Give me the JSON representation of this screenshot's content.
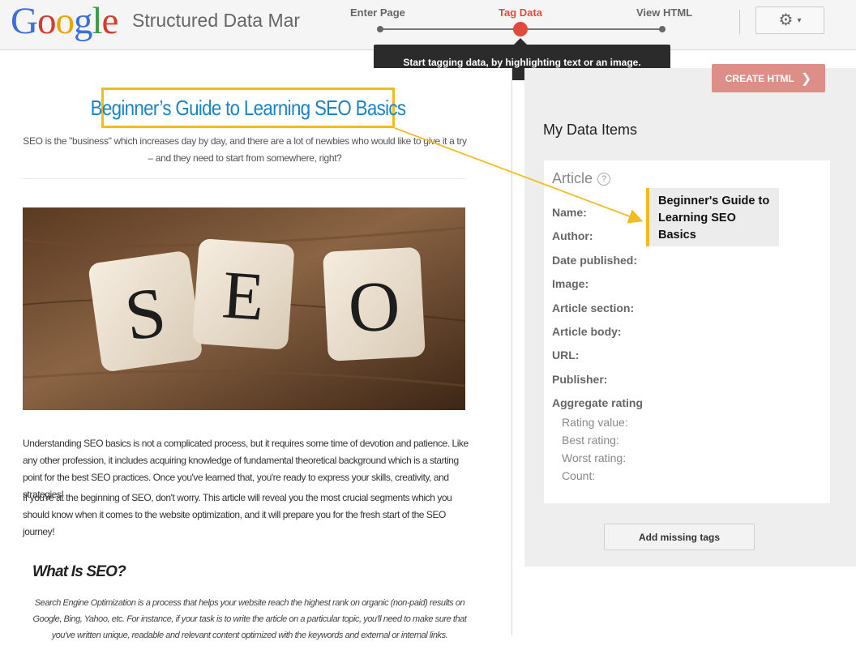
{
  "header": {
    "logo_letters": [
      "G",
      "o",
      "o",
      "g",
      "l",
      "e"
    ],
    "app_title": "Structured Data Mar",
    "steps": [
      {
        "label": "Enter Page",
        "active": false
      },
      {
        "label": "Tag Data",
        "active": true
      },
      {
        "label": "View HTML",
        "active": false
      }
    ],
    "settings_icon": "gear-icon",
    "settings_caret": "▾",
    "tooltip": "Start tagging data, by highlighting text or an image."
  },
  "article": {
    "headline": "Beginner’s Guide to Learning SEO Basics",
    "intro": "SEO is the \"business\" which increases day by day, and there are a lot of newbies who would like to give it a try – and they need to start from somewhere, right?",
    "image_tiles": [
      "S",
      "E",
      "O"
    ],
    "paragraph_1": "Understanding SEO basics is not a complicated process, but it requires some time of devotion and patience. Like any other profession, it includes acquiring knowledge of fundamental theoretical background which is a starting point for the best SEO practices. Once you've learned that, you're ready to express your skills, creativity, and strategies!",
    "paragraph_2": "If you're at the beginning of SEO, don't worry. This article will reveal you the most crucial segments which you should know when it comes to the website optimization, and it will prepare you for the fresh start of the SEO journey!",
    "section_title": "What Is SEO?",
    "section_body": "Search Engine Optimization is a process that helps your website reach the highest rank on organic (non-paid) results on Google, Bing, Yahoo, etc. For instance, if your task is to write the article on a particular topic, you'll need to make sure that you've written unique, readable and relevant content optimized with the keywords and external or internal links."
  },
  "panel": {
    "create_button": "CREATE HTML",
    "create_chevron": "❯",
    "title": "My Data Items",
    "card_title": "Article",
    "help_glyph": "?",
    "fields": [
      "Name:",
      "Author:",
      "Date published:",
      "Image:",
      "Article section:",
      "Article body:",
      "URL:",
      "Publisher:",
      "Aggregate rating"
    ],
    "subfields": [
      "Rating value:",
      "Best rating:",
      "Worst rating:",
      "Count:"
    ],
    "name_value": "Beginner's Guide to Learning SEO Basics",
    "add_missing": "Add missing tags"
  },
  "colors": {
    "accent_red": "#e04c3c",
    "highlight_yellow": "#f2bb1e",
    "headline_blue": "#1a84c8",
    "create_button": "#dd8e86"
  }
}
